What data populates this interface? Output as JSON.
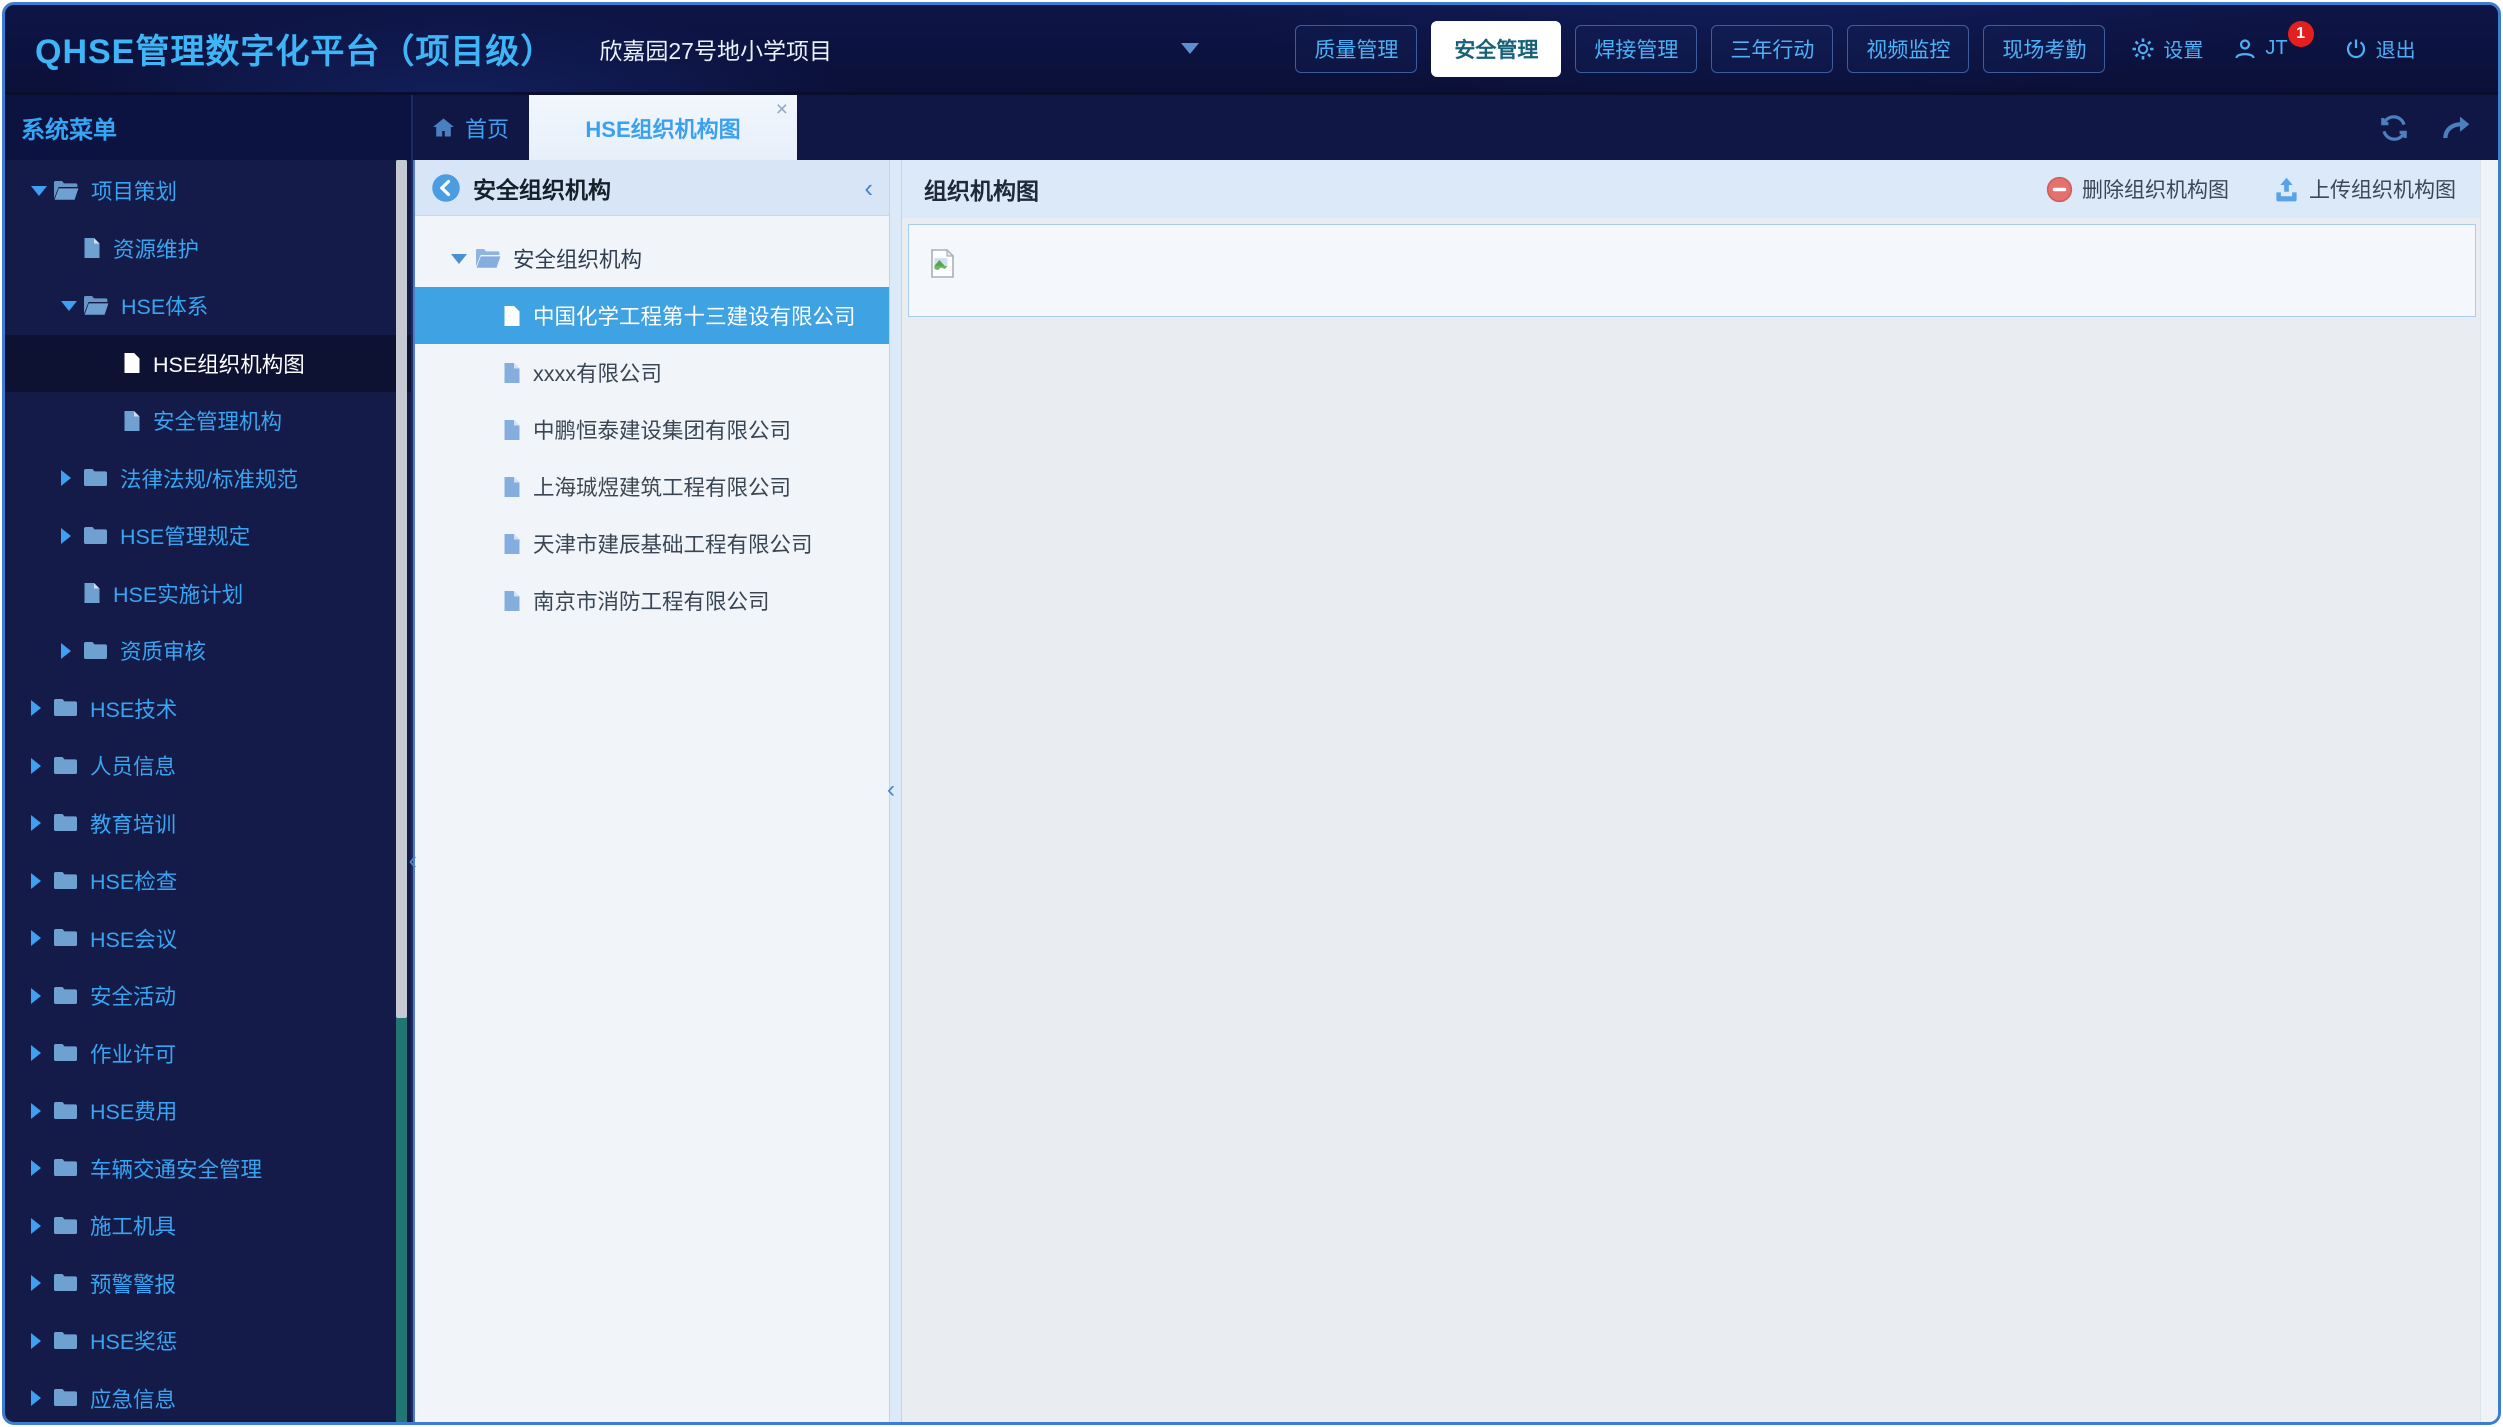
{
  "app": {
    "title": "QHSE管理数字化平台（项目级）"
  },
  "header": {
    "project_name": "欣嘉园27号地小学项目",
    "nav_buttons": [
      {
        "label": "质量管理",
        "active": false
      },
      {
        "label": "安全管理",
        "active": true
      },
      {
        "label": "焊接管理",
        "active": false
      },
      {
        "label": "三年行动",
        "active": false
      },
      {
        "label": "视频监控",
        "active": false
      },
      {
        "label": "现场考勤",
        "active": false
      }
    ],
    "settings_label": "设置",
    "user_label": "JT",
    "notification_count": "1",
    "logout_label": "退出"
  },
  "tabbar": {
    "home_label": "首页",
    "active_tab_label": "HSE组织机构图",
    "close_glyph": "×"
  },
  "sidebar": {
    "title": "系统菜单",
    "collapse_glyph": "‹",
    "tree": [
      {
        "label": "项目策划",
        "level": 1,
        "icon": "folder-open",
        "caret": "down",
        "selected": false
      },
      {
        "label": "资源维护",
        "level": 2,
        "icon": "file",
        "caret": null,
        "selected": false
      },
      {
        "label": "HSE体系",
        "level": 2,
        "icon": "folder-open",
        "caret": "down",
        "selected": false
      },
      {
        "label": "HSE组织机构图",
        "level": 3,
        "icon": "file",
        "caret": null,
        "selected": true
      },
      {
        "label": "安全管理机构",
        "level": 3,
        "icon": "file",
        "caret": null,
        "selected": false
      },
      {
        "label": "法律法规/标准规范",
        "level": 2,
        "icon": "folder",
        "caret": "right",
        "selected": false
      },
      {
        "label": "HSE管理规定",
        "level": 2,
        "icon": "folder",
        "caret": "right",
        "selected": false
      },
      {
        "label": "HSE实施计划",
        "level": 2,
        "icon": "file",
        "caret": null,
        "selected": false
      },
      {
        "label": "资质审核",
        "level": 2,
        "icon": "folder",
        "caret": "right",
        "selected": false
      },
      {
        "label": "HSE技术",
        "level": 1,
        "icon": "folder",
        "caret": "right",
        "selected": false
      },
      {
        "label": "人员信息",
        "level": 1,
        "icon": "folder",
        "caret": "right",
        "selected": false
      },
      {
        "label": "教育培训",
        "level": 1,
        "icon": "folder",
        "caret": "right",
        "selected": false
      },
      {
        "label": "HSE检查",
        "level": 1,
        "icon": "folder",
        "caret": "right",
        "selected": false
      },
      {
        "label": "HSE会议",
        "level": 1,
        "icon": "folder",
        "caret": "right",
        "selected": false
      },
      {
        "label": "安全活动",
        "level": 1,
        "icon": "folder",
        "caret": "right",
        "selected": false
      },
      {
        "label": "作业许可",
        "level": 1,
        "icon": "folder",
        "caret": "right",
        "selected": false
      },
      {
        "label": "HSE费用",
        "level": 1,
        "icon": "folder",
        "caret": "right",
        "selected": false
      },
      {
        "label": "车辆交通安全管理",
        "level": 1,
        "icon": "folder",
        "caret": "right",
        "selected": false
      },
      {
        "label": "施工机具",
        "level": 1,
        "icon": "folder",
        "caret": "right",
        "selected": false
      },
      {
        "label": "预警警报",
        "level": 1,
        "icon": "folder",
        "caret": "right",
        "selected": false
      },
      {
        "label": "HSE奖惩",
        "level": 1,
        "icon": "folder",
        "caret": "right",
        "selected": false
      },
      {
        "label": "应急信息",
        "level": 1,
        "icon": "folder",
        "caret": "right",
        "selected": false
      }
    ]
  },
  "org_panel": {
    "title": "安全组织机构",
    "collapse_glyph": "‹",
    "root_label": "安全组织机构",
    "companies": [
      {
        "name": "中国化学工程第十三建设有限公司",
        "selected": true
      },
      {
        "name": "xxxx有限公司",
        "selected": false
      },
      {
        "name": "中鹏恒泰建设集团有限公司",
        "selected": false
      },
      {
        "name": "上海珹煜建筑工程有限公司",
        "selected": false
      },
      {
        "name": "天津市建辰基础工程有限公司",
        "selected": false
      },
      {
        "name": "南京市消防工程有限公司",
        "selected": false
      }
    ]
  },
  "main": {
    "title": "组织机构图",
    "delete_button": "删除组织机构图",
    "upload_button": "上传组织机构图"
  },
  "colors": {
    "accent_blue": "#3eb5f6",
    "active_tab_text": "#3aa0f0",
    "selected_row_blue": "#3fa2e2",
    "selected_sidebar_bg": "#0d1233",
    "badge_red": "#e41f1f",
    "scroll_track_teal": "#217674",
    "panel_header_blue": "#d7e5f6",
    "delete_icon_red": "#e4716e",
    "upload_icon_blue": "#5aa2e8"
  }
}
